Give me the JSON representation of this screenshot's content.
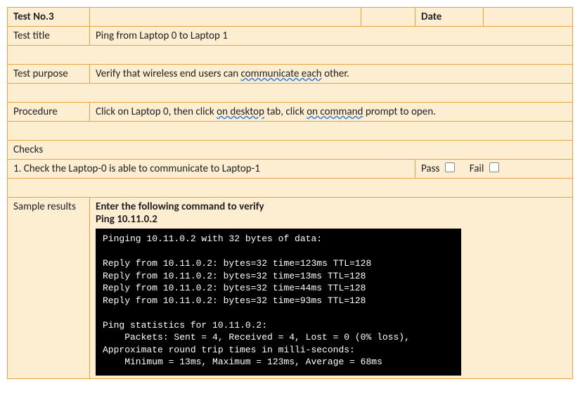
{
  "header": {
    "test_no_label": "Test No.3",
    "date_label": "Date",
    "date_value": ""
  },
  "title_row": {
    "label": "Test title",
    "value": "Ping from Laptop 0 to Laptop 1"
  },
  "purpose_row": {
    "label": "Test purpose",
    "text_before": "Verify that wireless end users can ",
    "spelled": "communicate each",
    "text_after": " other."
  },
  "procedure_row": {
    "label": "Procedure",
    "p1": "Click on Laptop 0, then click ",
    "s1": "on desktop",
    "p2": " tab, click ",
    "s2": "on command",
    "p3": " prompt to open."
  },
  "checks": {
    "heading": "Checks",
    "item1": "1.  Check the Laptop-0 is able to communicate to Laptop-1",
    "pass_label": "Pass",
    "fail_label": "Fail"
  },
  "sample": {
    "label": "Sample results",
    "instr_line1": "Enter the following command to verify",
    "instr_line2": "Ping 10.11.0.2",
    "terminal_lines": [
      "Pinging 10.11.0.2 with 32 bytes of data:",
      "",
      "Reply from 10.11.0.2: bytes=32 time=123ms TTL=128",
      "Reply from 10.11.0.2: bytes=32 time=13ms TTL=128",
      "Reply from 10.11.0.2: bytes=32 time=44ms TTL=128",
      "Reply from 10.11.0.2: bytes=32 time=93ms TTL=128",
      "",
      "Ping statistics for 10.11.0.2:",
      "    Packets: Sent = 4, Received = 4, Lost = 0 (0% loss),",
      "Approximate round trip times in milli-seconds:",
      "    Minimum = 13ms, Maximum = 123ms, Average = 68ms"
    ]
  }
}
